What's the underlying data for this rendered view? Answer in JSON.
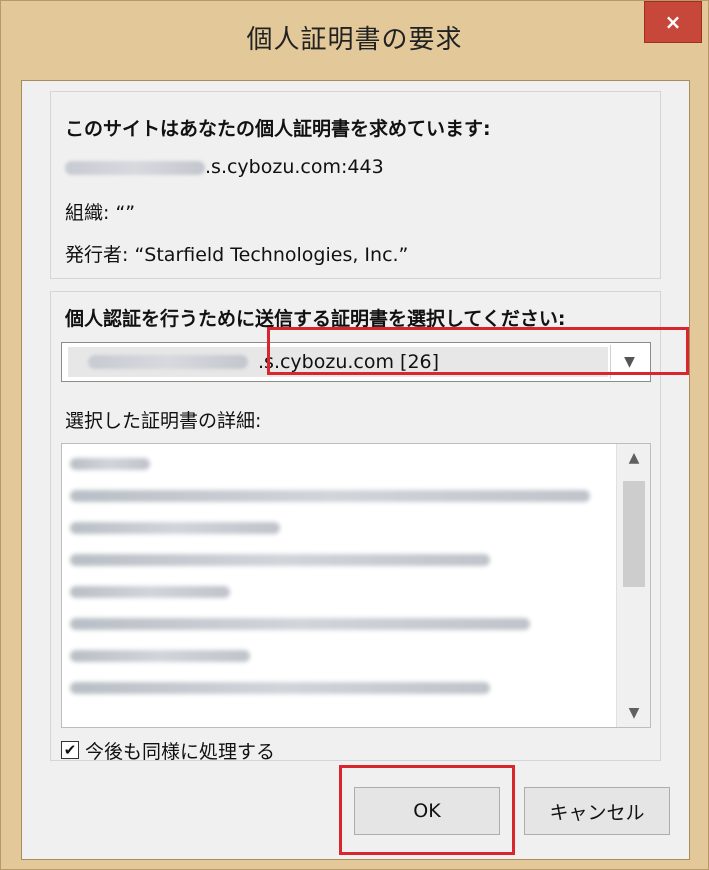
{
  "dialog": {
    "title": "個人証明書の要求",
    "close_label": "×"
  },
  "info": {
    "heading": "このサイトはあなたの個人証明書を求めています:",
    "site": ".s.cybozu.com:443",
    "org_label": "組織: “”",
    "issuer_label": "発行者: “Starfield Technologies, Inc.”"
  },
  "select": {
    "heading": "個人認証を行うために送信する証明書を選択してください:",
    "selected_value": ".s.cybozu.com [26]",
    "details_label": "選択した証明書の詳細:",
    "checkbox_label": "今後も同様に処理する",
    "checkbox_checked": true
  },
  "buttons": {
    "ok": "OK",
    "cancel": "キャンセル"
  },
  "icons": {
    "close": "close-icon",
    "dropdown": "chevron-down-icon",
    "scroll_up": "chevron-up-icon",
    "scroll_down": "chevron-down-icon",
    "check": "checkmark-icon"
  },
  "colors": {
    "window_frame": "#e3c99a",
    "close_button": "#c7483a",
    "highlight": "#d9262e",
    "client_bg": "#f0f0f0"
  }
}
